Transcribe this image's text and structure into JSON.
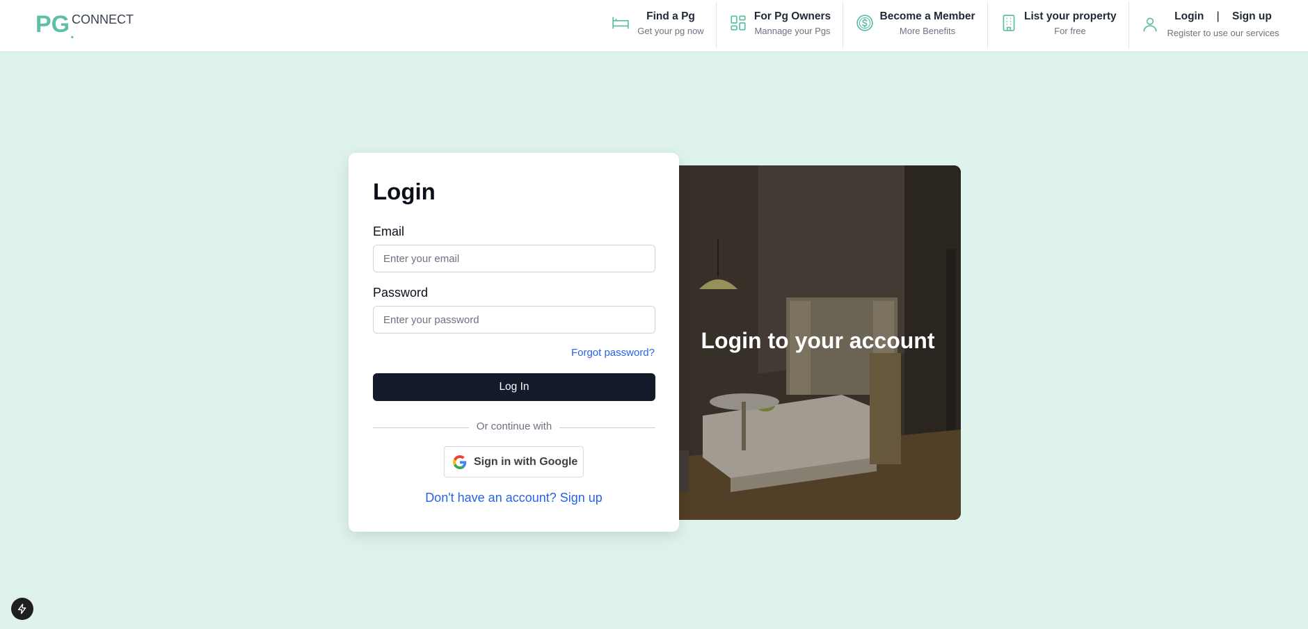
{
  "logo": {
    "brand": "PG",
    "dot": ".",
    "sub": "CONNECT"
  },
  "nav": [
    {
      "title": "Find a Pg",
      "subtitle": "Get your pg now",
      "icon": "bed-icon"
    },
    {
      "title": "For Pg Owners",
      "subtitle": "Mannage your Pgs",
      "icon": "dashboard-icon"
    },
    {
      "title": "Become a Member",
      "subtitle": "More Benefits",
      "icon": "dollar-circle-icon"
    },
    {
      "title": "List your property",
      "subtitle": "For free",
      "icon": "building-icon"
    }
  ],
  "account": {
    "login": "Login",
    "separator": "|",
    "signup": "Sign up",
    "subtitle": "Register to use our services",
    "icon": "user-icon"
  },
  "form": {
    "title": "Login",
    "email_label": "Email",
    "email_placeholder": "Enter your email",
    "password_label": "Password",
    "password_placeholder": "Enter your password",
    "forgot": "Forgot password?",
    "submit": "Log In",
    "divider": "Or continue with",
    "google": "Sign in with Google",
    "signup_prompt": "Don't have an account? Sign up"
  },
  "hero": {
    "heading": "Login to your account"
  },
  "colors": {
    "accent": "#5dbfa6",
    "background": "#dff3ee",
    "button": "#141a2a",
    "link": "#2563eb"
  }
}
